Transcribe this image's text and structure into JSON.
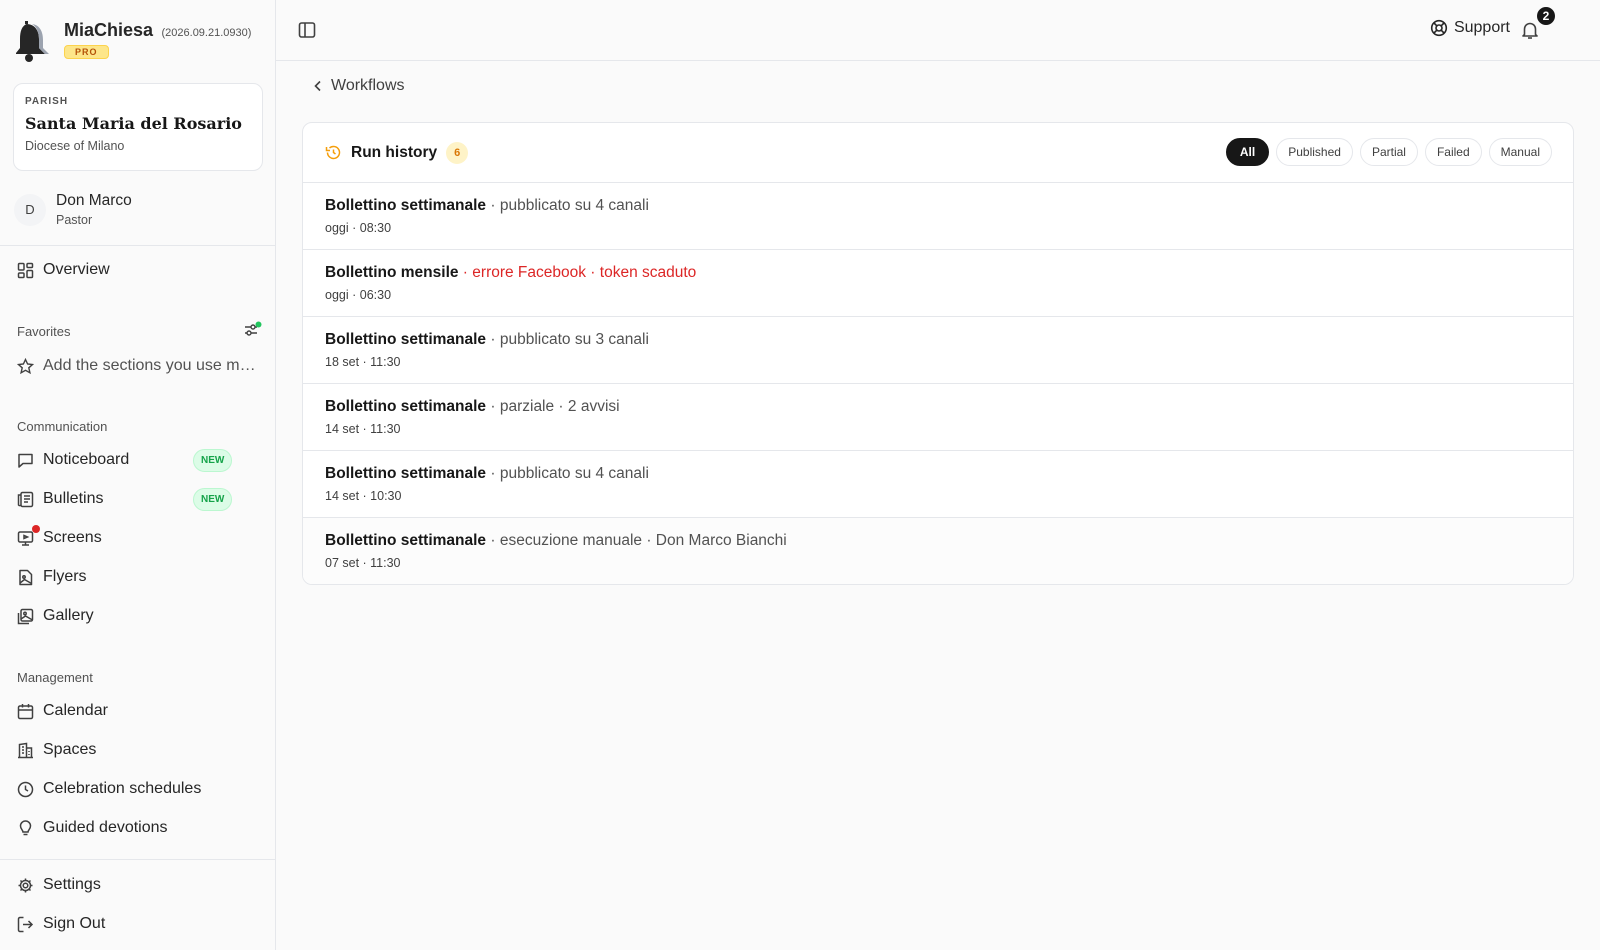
{
  "brand": {
    "name": "MiaChiesa",
    "version": "(2026.09.21.0930)",
    "plan": "PRO"
  },
  "parish": {
    "label": "PARISH",
    "name": "Santa Maria del Rosario",
    "diocese": "Diocese of Milano"
  },
  "user": {
    "initial": "D",
    "name": "Don Marco",
    "role": "Pastor"
  },
  "nav": {
    "overview": "Overview",
    "favorites_title": "Favorites",
    "favorites_placeholder": "Add the sections you use most",
    "communication_title": "Communication",
    "communication": [
      {
        "label": "Noticeboard",
        "badge": "NEW"
      },
      {
        "label": "Bulletins",
        "badge": "NEW"
      },
      {
        "label": "Screens"
      },
      {
        "label": "Flyers"
      },
      {
        "label": "Gallery"
      }
    ],
    "management_title": "Management",
    "management": [
      {
        "label": "Calendar"
      },
      {
        "label": "Spaces"
      },
      {
        "label": "Celebration schedules"
      },
      {
        "label": "Guided devotions"
      }
    ],
    "settings": "Settings",
    "sign_out": "Sign Out"
  },
  "topbar": {
    "support": "Support",
    "notifications_count": "2"
  },
  "breadcrumb": {
    "back_label": "Workflows"
  },
  "run_history": {
    "title": "Run history",
    "count": "6",
    "filters": [
      "All",
      "Published",
      "Partial",
      "Failed",
      "Manual"
    ],
    "active_filter": "All",
    "runs": [
      {
        "name": "Bollettino settimanale",
        "detail": "pubblicato su 4 canali",
        "time": "oggi · 08:30",
        "status": "published"
      },
      {
        "name": "Bollettino mensile",
        "detail": "errore Facebook · token scaduto",
        "time": "oggi · 06:30",
        "status": "failed"
      },
      {
        "name": "Bollettino settimanale",
        "detail": "pubblicato su 3 canali",
        "time": "18 set · 11:30",
        "status": "published"
      },
      {
        "name": "Bollettino settimanale",
        "detail": "parziale · 2 avvisi",
        "time": "14 set · 11:30",
        "status": "partial"
      },
      {
        "name": "Bollettino settimanale",
        "detail": "pubblicato su 4 canali",
        "time": "14 set · 10:30",
        "status": "published"
      },
      {
        "name": "Bollettino settimanale",
        "detail": "esecuzione manuale · Don Marco Bianchi",
        "time": "07 set · 11:30",
        "status": "manual"
      }
    ]
  },
  "colors": {
    "accent_dark": "#171717",
    "error": "#dc2626",
    "new_badge": "#16a34a",
    "pro_badge": "#fde68a",
    "count_badge": "#d97706"
  },
  "icons": [
    "bell-logo-icon",
    "panel-toggle-icon",
    "lifebuoy-icon",
    "bell-icon",
    "chevron-left-icon",
    "history-icon",
    "grid-icon",
    "star-icon",
    "favorites-settings-icon",
    "message-square-icon",
    "newspaper-icon",
    "screen-icon",
    "file-image-icon",
    "images-icon",
    "calendar-icon",
    "building-icon",
    "clock-icon",
    "lightbulb-icon",
    "gear-icon",
    "log-out-icon"
  ]
}
